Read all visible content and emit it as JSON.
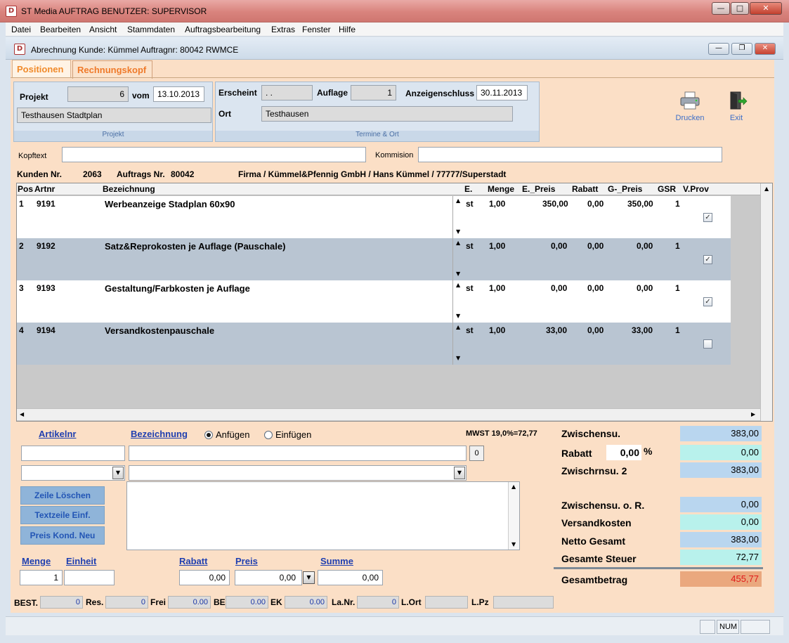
{
  "window": {
    "title": "ST Media AUFTRAG BENUTZER: SUPERVISOR"
  },
  "menu": [
    "Datei",
    "Bearbeiten",
    "Ansicht",
    "Stammdaten",
    "Auftragsbearbeitung",
    "Extras",
    "Fenster",
    "Hilfe"
  ],
  "child": {
    "title": "Abrechnung Kunde: Kümmel Auftragnr: 80042  RWMCE"
  },
  "tabs": {
    "positionen": "Positionen",
    "rechnungskopf": "Rechnungskopf"
  },
  "projekt": {
    "label": "Projekt",
    "number": "6",
    "vom_label": "vom",
    "date": "13.10.2013",
    "name": "Testhausen Stadtplan",
    "group_label": "Projekt"
  },
  "termine": {
    "erscheint_label": "Erscheint",
    "erscheint": ". .",
    "auflage_label": "Auflage",
    "auflage": "1",
    "anzeigenschluss_label": "Anzeigenschluss",
    "anzeigenschluss": "30.11.2013",
    "ort_label": "Ort",
    "ort": "Testhausen",
    "group_label": "Termine & Ort"
  },
  "tools": {
    "print": "Drucken",
    "exit": "Exit"
  },
  "kopf": {
    "kopftext_label": "Kopftext",
    "kommision_label": "Kommision"
  },
  "kunde": {
    "kunden_label": "Kunden Nr.",
    "kunden_nr": "2063",
    "auftrags_label": "Auftrags Nr.",
    "auftrags_nr": "80042",
    "firma": "Firma / Kümmel&Pfennig GmbH / Hans Kümmel / 77777/Superstadt"
  },
  "grid": {
    "headers": {
      "pos": "Pos",
      "artnr": "Artnr",
      "bez": "Bezeichnung",
      "e": "E.",
      "menge": "Menge",
      "epreis": "E._Preis",
      "rabatt": "Rabatt",
      "gpreis": "G-_Preis",
      "gsr": "GSR",
      "vprov": "V.Prov"
    },
    "rows": [
      {
        "pos": "1",
        "artnr": "9191",
        "bez": "Werbeanzeige Stadplan 60x90",
        "e": "st",
        "menge": "1,00",
        "epreis": "350,00",
        "rabatt": "0,00",
        "gpreis": "350,00",
        "gsr": "1",
        "vprov": true
      },
      {
        "pos": "2",
        "artnr": "9192",
        "bez": "Satz&Reprokosten je Auflage (Pauschale)",
        "e": "st",
        "menge": "1,00",
        "epreis": "0,00",
        "rabatt": "0,00",
        "gpreis": "0,00",
        "gsr": "1",
        "vprov": true
      },
      {
        "pos": "3",
        "artnr": "9193",
        "bez": "Gestaltung/Farbkosten je Auflage",
        "e": "st",
        "menge": "1,00",
        "epreis": "0,00",
        "rabatt": "0,00",
        "gpreis": "0,00",
        "gsr": "1",
        "vprov": true
      },
      {
        "pos": "4",
        "artnr": "9194",
        "bez": "Versandkostenpauschale",
        "e": "st",
        "menge": "1,00",
        "epreis": "33,00",
        "rabatt": "0,00",
        "gpreis": "33,00",
        "gsr": "1",
        "vprov": false
      }
    ]
  },
  "entry": {
    "artikelnr_label": "Artikelnr",
    "bezeichnung_label": "Bezeichnung",
    "anfuegen": "Anfügen",
    "einfuegen": "Einfügen",
    "mwst": "MWST 19,0%=72,77",
    "count": "0",
    "btn_zeile_loeschen": "Zeile Löschen",
    "btn_textzeile": "Textzeile Einf.",
    "btn_preis_kond": "Preis Kond. Neu",
    "menge_label": "Menge",
    "einheit_label": "Einheit",
    "rabatt_label": "Rabatt",
    "preis_label": "Preis",
    "summe_label": "Summe",
    "menge": "1",
    "rabatt": "0,00",
    "preis": "0,00",
    "summe": "0,00"
  },
  "summary": {
    "zwischensu_label": "Zwischensu.",
    "zwischensu": "383,00",
    "rabatt_label": "Rabatt",
    "rabatt_pct": "0,00",
    "pct": "%",
    "rabatt_val": "0,00",
    "zwischensu2_label": "Zwischrnsu. 2",
    "zwischensu2": "383,00",
    "zwischensu_or_label": "Zwischensu. o. R.",
    "zwischensu_or": "0,00",
    "versand_label": "Versandkosten",
    "versand": "0,00",
    "netto_label": "Netto Gesamt",
    "netto": "383,00",
    "steuer_label": "Gesamte Steuer",
    "steuer": "72,77",
    "gesamt_label": "Gesamtbetrag",
    "gesamt": "455,77"
  },
  "stock": {
    "best_label": "BEST.",
    "best": "0",
    "res_label": "Res.",
    "res": "0",
    "frei_label": "Frei",
    "frei": "0.00",
    "be_label": "BE",
    "be": "0.00",
    "ek_label": "EK",
    "ek": "0.00",
    "lanr_label": "La.Nr.",
    "lanr": "0",
    "lort_label": "L.Ort",
    "lpz_label": "L.Pz"
  },
  "status": {
    "num": "NUM"
  },
  "colors": {
    "accent_orange": "#f08a2a",
    "link_blue": "#1f3fb0",
    "total_red": "#e01818",
    "panel_peach": "#fbdfc6"
  }
}
